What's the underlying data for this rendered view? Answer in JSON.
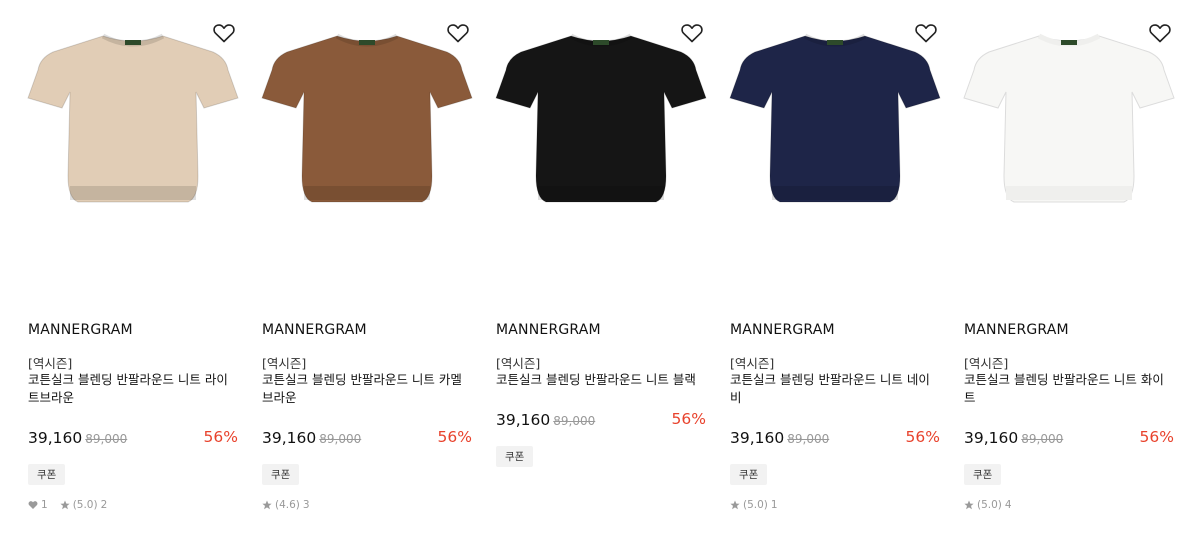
{
  "accent_color": "#e8422c",
  "products": [
    {
      "brand": "MANNERGRAM",
      "category": "[역시즌]",
      "name": "코튼실크 블렌딩 반팔라운드 니트 라이트브라운",
      "price": "39,160",
      "original_price": "89,000",
      "discount": "56%",
      "coupon": "쿠폰",
      "likes": "1",
      "rating": "(5.0)",
      "reviews": "2",
      "color": "#e1cdb6",
      "icons": [
        "heart-outline-icon",
        "heart-icon",
        "star-icon"
      ]
    },
    {
      "brand": "MANNERGRAM",
      "category": "[역시즌]",
      "name": "코튼실크 블렌딩 반팔라운드 니트 카멜브라운",
      "price": "39,160",
      "original_price": "89,000",
      "discount": "56%",
      "coupon": "쿠폰",
      "rating": "(4.6)",
      "reviews": "3",
      "color": "#8a5a3a",
      "icons": [
        "heart-outline-icon",
        "star-icon"
      ]
    },
    {
      "brand": "MANNERGRAM",
      "category": "[역시즌]",
      "name": "코튼실크 블렌딩 반팔라운드 니트 블랙",
      "price": "39,160",
      "original_price": "89,000",
      "discount": "56%",
      "coupon": "쿠폰",
      "color": "#151515",
      "icons": [
        "heart-outline-icon"
      ]
    },
    {
      "brand": "MANNERGRAM",
      "category": "[역시즌]",
      "name": "코튼실크 블렌딩 반팔라운드 니트 네이비",
      "price": "39,160",
      "original_price": "89,000",
      "discount": "56%",
      "coupon": "쿠폰",
      "rating": "(5.0)",
      "reviews": "1",
      "color": "#1e2548",
      "icons": [
        "heart-outline-icon",
        "star-icon"
      ]
    },
    {
      "brand": "MANNERGRAM",
      "category": "[역시즌]",
      "name": "코튼실크 블렌딩 반팔라운드 니트 화이트",
      "price": "39,160",
      "original_price": "89,000",
      "discount": "56%",
      "coupon": "쿠폰",
      "rating": "(5.0)",
      "reviews": "4",
      "color": "#f7f7f5",
      "icons": [
        "heart-outline-icon",
        "star-icon"
      ]
    }
  ]
}
